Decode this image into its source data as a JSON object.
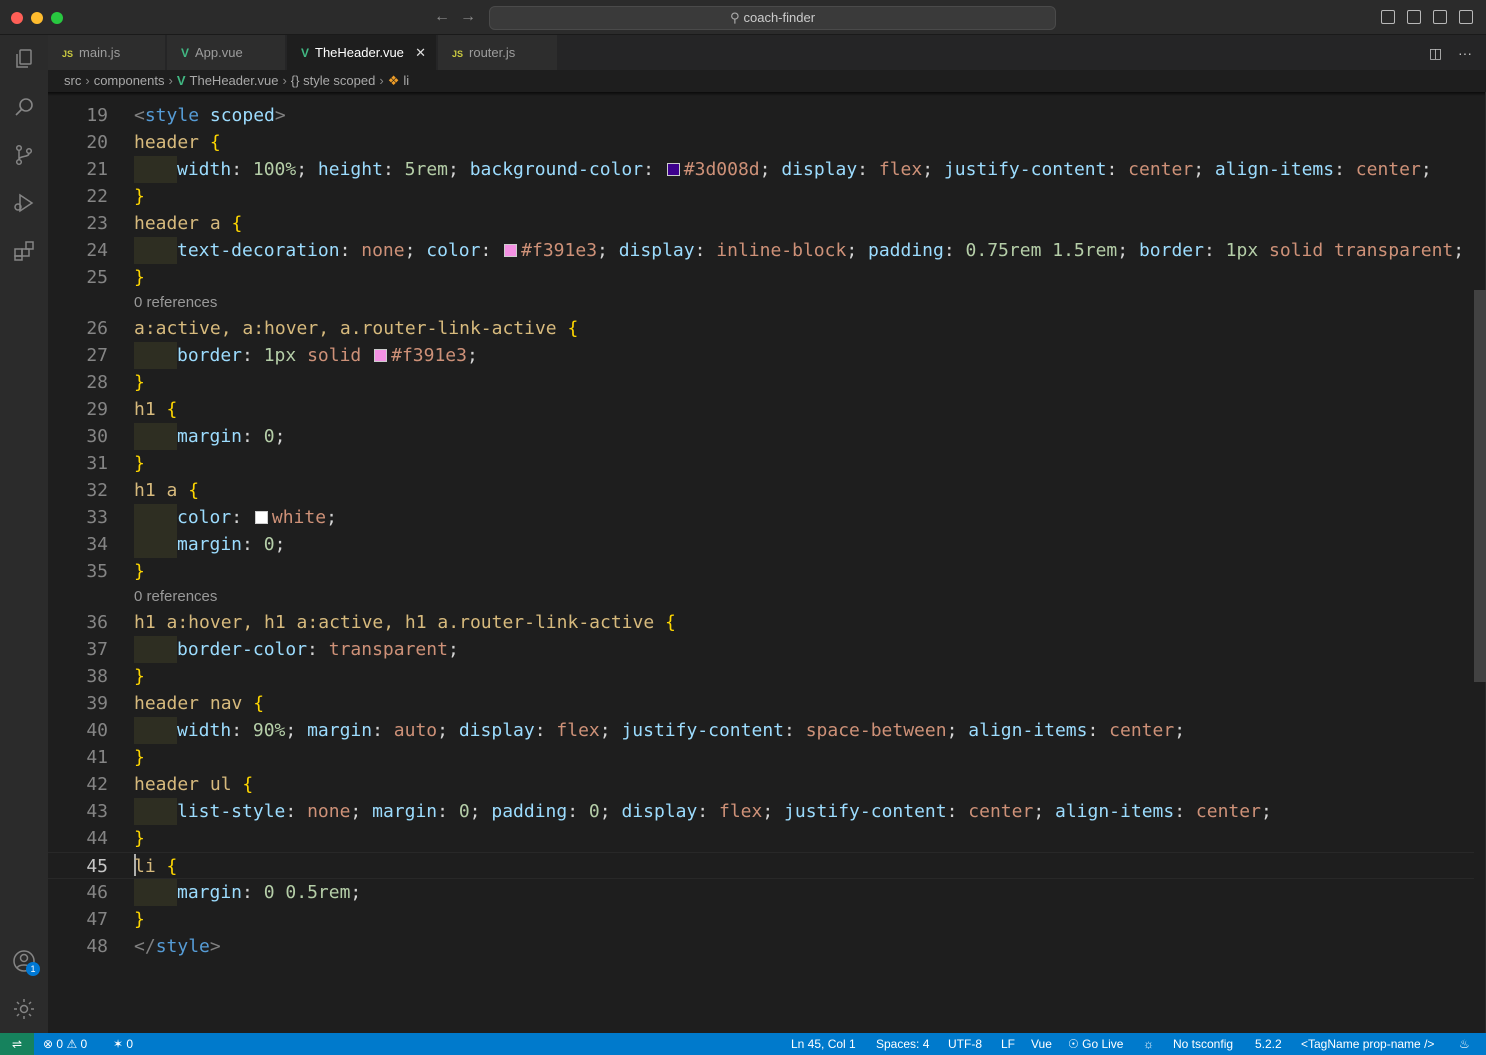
{
  "window": {
    "search_text": "coach-finder"
  },
  "tabs": [
    {
      "label": "main.js",
      "type": "JS"
    },
    {
      "label": "App.vue",
      "type": "vue"
    },
    {
      "label": "TheHeader.vue",
      "type": "vue",
      "active": true
    },
    {
      "label": "router.js",
      "type": "JS"
    }
  ],
  "breadcrumb": [
    "src",
    "components",
    "TheHeader.vue",
    "{} style scoped",
    "li"
  ],
  "editor": {
    "references_label": "0 references",
    "lines": [
      {
        "n": "19",
        "text": "<style scoped>"
      },
      {
        "n": "20",
        "text": "header {"
      },
      {
        "n": "21",
        "text": "width: 100%; height: 5rem; background-color: #3d008d; display: flex; justify-content: center; align-items: center;"
      },
      {
        "n": "22",
        "text": "}"
      },
      {
        "n": "23",
        "text": "header a {"
      },
      {
        "n": "24",
        "text": "text-decoration: none; color: #f391e3; display: inline-block; padding: 0.75rem 1.5rem; border: 1px solid transparent;"
      },
      {
        "n": "25",
        "text": "}"
      },
      {
        "n": "26",
        "text": "a:active, a:hover, a.router-link-active {"
      },
      {
        "n": "27",
        "text": "border: 1px solid #f391e3;"
      },
      {
        "n": "28",
        "text": "}"
      },
      {
        "n": "29",
        "text": "h1 {"
      },
      {
        "n": "30",
        "text": "margin: 0;"
      },
      {
        "n": "31",
        "text": "}"
      },
      {
        "n": "32",
        "text": "h1 a {"
      },
      {
        "n": "33",
        "text": "color: white;"
      },
      {
        "n": "34",
        "text": "margin: 0;"
      },
      {
        "n": "35",
        "text": "}"
      },
      {
        "n": "36",
        "text": "h1 a:hover, h1 a:active, h1 a.router-link-active {"
      },
      {
        "n": "37",
        "text": "border-color: transparent;"
      },
      {
        "n": "38",
        "text": "}"
      },
      {
        "n": "39",
        "text": "header nav {"
      },
      {
        "n": "40",
        "text": "width: 90%; margin: auto; display: flex; justify-content: space-between; align-items: center;"
      },
      {
        "n": "41",
        "text": "}"
      },
      {
        "n": "42",
        "text": "header ul {"
      },
      {
        "n": "43",
        "text": "list-style: none; margin: 0; padding: 0; display: flex; justify-content: center; align-items: center;"
      },
      {
        "n": "44",
        "text": "}"
      },
      {
        "n": "45",
        "text": "li {"
      },
      {
        "n": "46",
        "text": "margin: 0 0.5rem;"
      },
      {
        "n": "47",
        "text": "}"
      },
      {
        "n": "48",
        "text": "</style>"
      }
    ],
    "swatch_colors": {
      "purple": "#3d008d",
      "pink": "#f391e3",
      "white": "#ffffff"
    }
  },
  "activity": {
    "accounts_badge": "1"
  },
  "status": {
    "errors": "0",
    "warnings": "0",
    "ports": "0",
    "position": "Ln 45, Col 1",
    "spaces": "Spaces: 4",
    "encoding": "UTF-8",
    "eol": "LF",
    "language": "Vue",
    "go_live": "Go Live",
    "tsconfig": "No tsconfig",
    "ts_version": "5.2.2",
    "tag_format": "<TagName prop-name />"
  }
}
